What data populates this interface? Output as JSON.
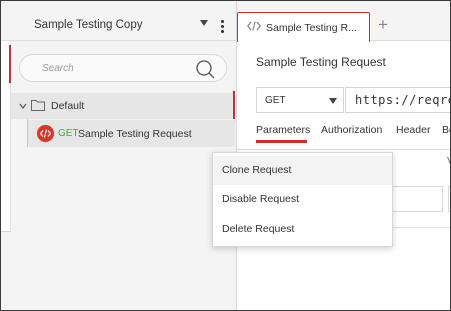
{
  "sidebar": {
    "collection_name": "Sample Testing Copy",
    "search_placeholder": "Search",
    "folder": {
      "label": "Default"
    },
    "request": {
      "method": "GET",
      "name": "Sample Testing Request"
    }
  },
  "tabs": {
    "active_tab_label": "Sample Testing R...",
    "new_tab_glyph": "+"
  },
  "request_editor": {
    "title": "Sample Testing Request",
    "method": "GET",
    "url": "https://reqre",
    "subtabs": [
      "Parameters",
      "Authorization",
      "Header",
      "Bo"
    ],
    "active_subtab": "Parameters",
    "partial_column_label": "V"
  },
  "context_menu": {
    "items": [
      "Clone Request",
      "Disable Request",
      "Delete Request"
    ],
    "highlighted": "Clone Request"
  },
  "colors": {
    "accent": "#c9302c",
    "method_get": "#3fa93b",
    "request_icon_bg": "#d9352a"
  },
  "icons": {
    "search": "search-icon",
    "folder": "folder-icon",
    "chevron": "chevron-down-icon",
    "request": "code-icon",
    "tab": "code-icon",
    "kebab": "kebab-menu-icon",
    "caret": "caret-down-icon"
  }
}
